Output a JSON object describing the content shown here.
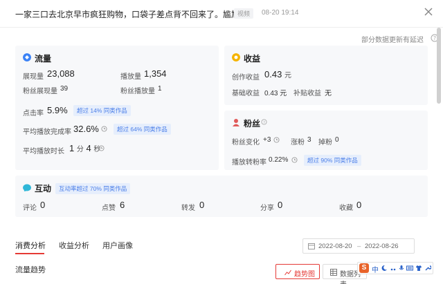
{
  "header": {
    "title": "一家三口去北京早市疯狂购物，口袋子差点背不回来了。尴尬了。",
    "tag": "视频",
    "date": "08-20 19:14"
  },
  "notice": "部分数据更新有延迟",
  "flow": {
    "title": "流量",
    "impressions_label": "展现量",
    "impressions_value": "23,088",
    "plays_label": "播放量",
    "plays_value": "1,354",
    "fan_impressions_label": "粉丝展现量",
    "fan_impressions_value": "39",
    "fan_plays_label": "粉丝播放量",
    "fan_plays_value": "1",
    "ctr_label": "点击率",
    "ctr_value": "5.9%",
    "ctr_chip": "超过 14% 同类作品",
    "completion_label": "平均播放完成率",
    "completion_value": "32.6%",
    "completion_chip": "超过 64% 同类作品",
    "duration_label": "平均播放时长",
    "duration_min": "1",
    "duration_min_unit": "分",
    "duration_sec": "4",
    "duration_sec_unit": "秒"
  },
  "income": {
    "title": "收益",
    "creation_label": "创作收益",
    "creation_value": "0.43",
    "creation_unit": "元",
    "base_label": "基础收益",
    "base_value": "0.43 元",
    "subsidy_label": "补贴收益",
    "subsidy_value": "无"
  },
  "fans": {
    "title": "粉丝",
    "change_label": "粉丝变化",
    "change_value": "+3",
    "gain_label": "涨粉",
    "gain_value": "3",
    "lost_label": "掉粉",
    "lost_value": "0",
    "conversion_label": "播放转粉率",
    "conversion_value": "0.22%",
    "conversion_chip": "超过 90% 同类作品"
  },
  "interact": {
    "title": "互动",
    "chip": "互动率超过 70% 同类作品",
    "items": [
      {
        "label": "评论",
        "value": "0"
      },
      {
        "label": "点赞",
        "value": "6"
      },
      {
        "label": "转发",
        "value": "0"
      },
      {
        "label": "分享",
        "value": "0"
      },
      {
        "label": "收藏",
        "value": "0"
      }
    ]
  },
  "tabs": [
    "消费分析",
    "收益分析",
    "用户画像"
  ],
  "daterange": {
    "start": "2022-08-20",
    "sep": "–",
    "end": "2022-08-26"
  },
  "section_title": "流量趋势",
  "buttons": {
    "trend": "趋势图",
    "list": "数据列表"
  },
  "ime": {
    "logo": "S",
    "lang": "中"
  },
  "colors": {
    "accent": "#e53935",
    "chip_text": "#4a7ee8",
    "chip_bg": "#e6eefc",
    "flow_icon": "#3b82f6",
    "income_icon": "#f5b400",
    "fans_icon": "#e05a5a",
    "interact_icon": "#2fb7d8"
  }
}
